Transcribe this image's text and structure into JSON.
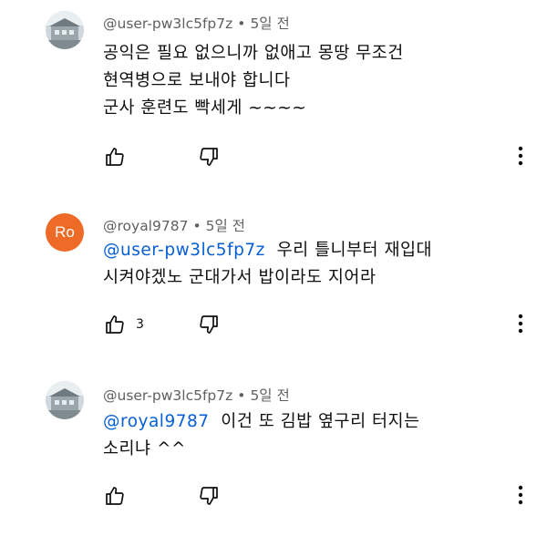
{
  "comments": [
    {
      "author": "@user-pw3lc5fp7z",
      "time": "5일 전",
      "lines": [
        "공익은 필요 없으니까 없애고 몽땅 무조건",
        "현역병으로 보내야 합니다",
        "군사 훈련도 빡세게 ~~~~"
      ],
      "likes": ""
    },
    {
      "author": "@royal9787",
      "avatar_letters": "Ro",
      "time": "5일 전",
      "mention": "@user-pw3lc5fp7z",
      "lines": [
        "우리 틀니부터 재입대",
        "시켜야겠노 군대가서 밥이라도 지어라"
      ],
      "likes": "3"
    },
    {
      "author": "@user-pw3lc5fp7z",
      "time": "5일 전",
      "mention": "@royal9787",
      "lines": [
        "이건 또 김밥 옆구리 터지는",
        "소리냐 ^^"
      ],
      "likes": ""
    }
  ],
  "separator": "•",
  "icons": {
    "like": "thumb-up-icon",
    "dislike": "thumb-down-icon",
    "more": "more-vert-icon",
    "avatar_photo": "house-photo-avatar"
  },
  "colors": {
    "mention": "#065fd4",
    "avatar_orange": "#ee6a27",
    "meta_gray": "#606060"
  }
}
